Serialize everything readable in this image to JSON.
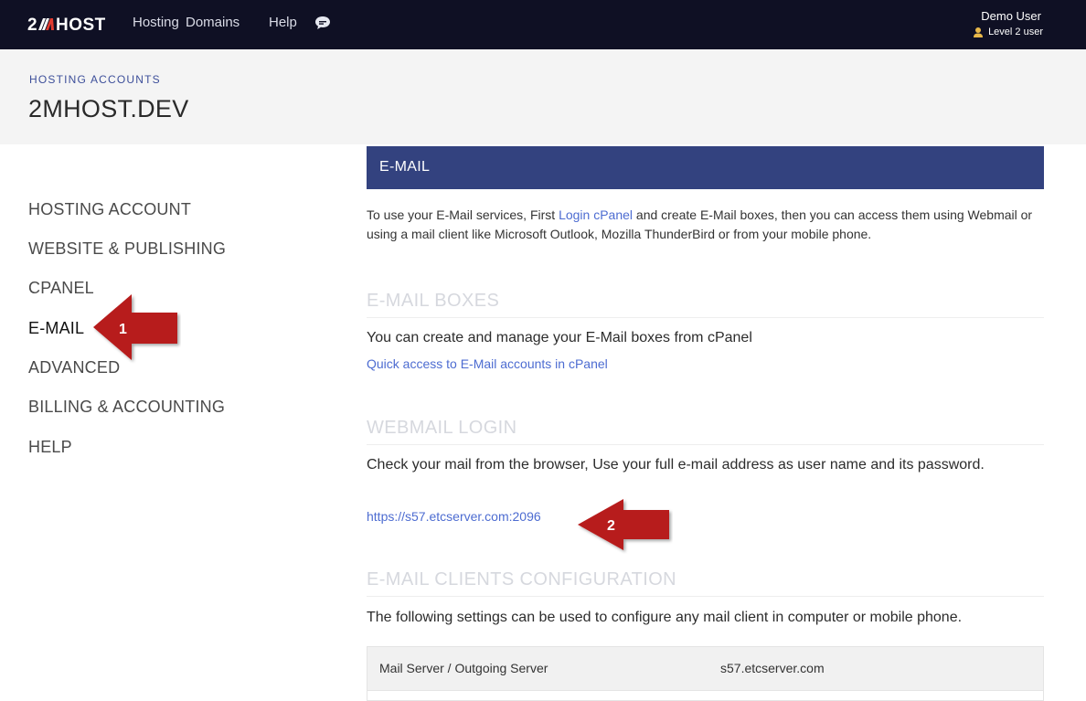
{
  "topnav": {
    "logo": "2MHOST",
    "links": [
      "Hosting",
      "Domains",
      "Help"
    ],
    "user_name": "Demo User",
    "user_level": "Level 2 user"
  },
  "header": {
    "breadcrumb": "HOSTING ACCOUNTS",
    "title": "2MHOST.DEV"
  },
  "sidebar": {
    "items": [
      {
        "label": "HOSTING ACCOUNT"
      },
      {
        "label": "WEBSITE & PUBLISHING"
      },
      {
        "label": "CPANEL"
      },
      {
        "label": "E-MAIL",
        "active": true
      },
      {
        "label": "ADVANCED"
      },
      {
        "label": "BILLING & ACCOUNTING"
      },
      {
        "label": "HELP"
      }
    ]
  },
  "main": {
    "section_title": "E-MAIL",
    "intro_before": "To use your E-Mail services, First ",
    "intro_link": "Login cPanel",
    "intro_after": " and create E-Mail boxes, then you can access them using Webmail or using a mail client like Microsoft Outlook, Mozilla ThunderBird or from your mobile phone.",
    "boxes_heading": "E-MAIL BOXES",
    "boxes_text": "You can create and manage your E-Mail boxes from cPanel",
    "boxes_link": "Quick access to E-Mail accounts in cPanel",
    "webmail_heading": "WEBMAIL LOGIN",
    "webmail_text": "Check your mail from the browser, Use your full e-mail address as user name and its password.",
    "webmail_link": "https://s57.etcserver.com:2096",
    "clients_heading": "E-MAIL CLIENTS CONFIGURATION",
    "clients_text": "The following settings can be used to configure any mail client in computer or mobile phone.",
    "table": [
      {
        "label": "Mail Server / Outgoing Server",
        "value": "s57.etcserver.com"
      }
    ]
  },
  "annotations": {
    "arrow1_label": "1",
    "arrow2_label": "2",
    "arrow_color": "#b71c1c"
  }
}
